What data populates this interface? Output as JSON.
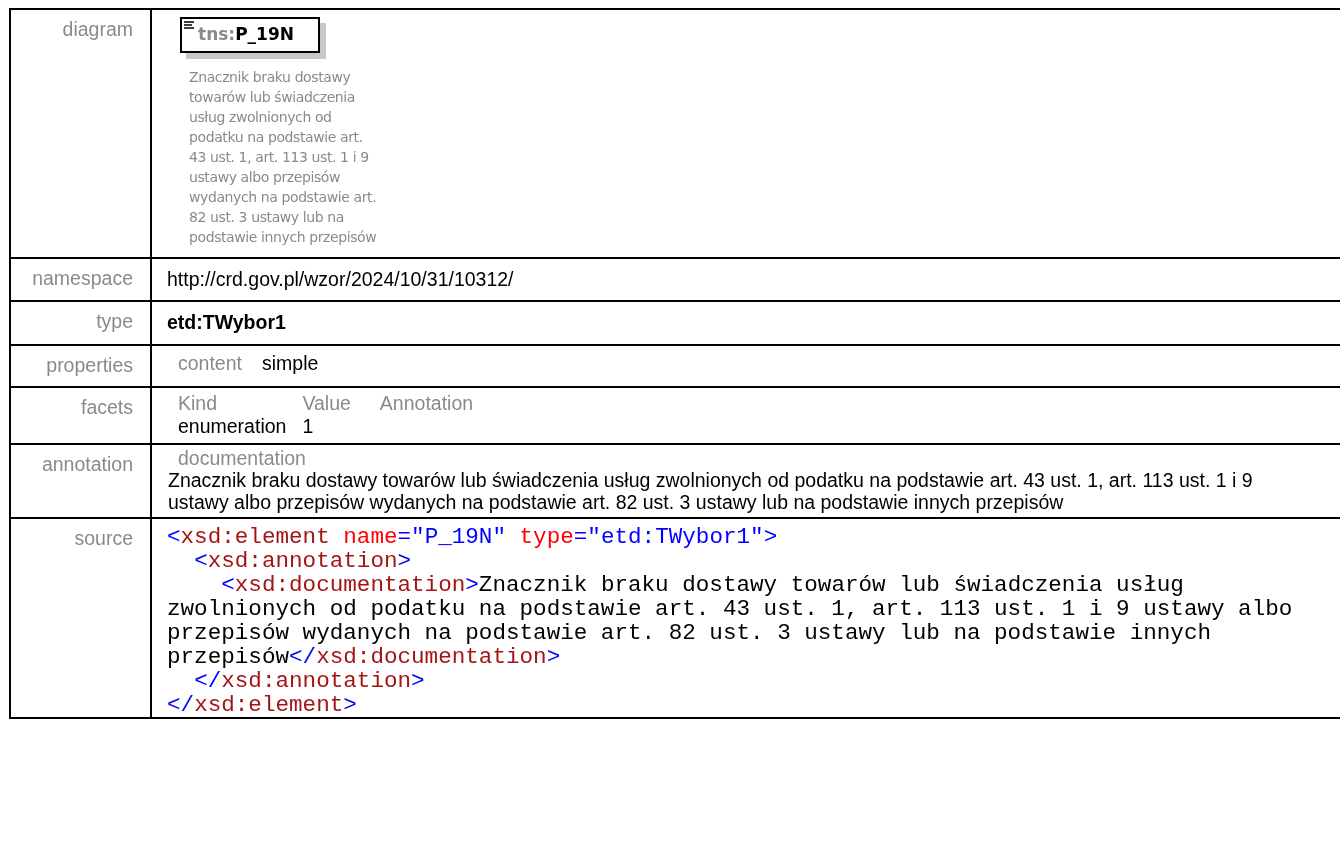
{
  "rows": [
    {
      "kind": "diagram",
      "label": "diagram",
      "prefix": "tns:",
      "name": "P_19N",
      "description": "Znacznik braku dostawy towarów lub świadczenia usług zwolnionych od podatku na podstawie art. 43 ust. 1, art. 113 ust. 1 i 9 ustawy albo przepisów wydanych na podstawie art. 82 ust. 3 ustawy lub na podstawie innych przepisów"
    },
    {
      "kind": "text",
      "label": "namespace",
      "value": "http://crd.gov.pl/wzor/2024/10/31/10312/"
    },
    {
      "kind": "bold",
      "label": "type",
      "value": "etd:TWybor1"
    },
    {
      "kind": "pairs",
      "label": "properties",
      "pairs": [
        {
          "key": "content",
          "value": "simple"
        }
      ]
    },
    {
      "kind": "facets",
      "label": "facets",
      "columns": [
        "Kind",
        "Value",
        "Annotation"
      ],
      "rows": [
        [
          "enumeration",
          "1",
          ""
        ]
      ]
    },
    {
      "kind": "annotation",
      "label": "annotation",
      "heading": "documentation",
      "value": "Znacznik braku dostawy towarów lub świadczenia usług zwolnionych od podatku na podstawie art. 43 ust. 1, art. 113 ust. 1 i 9 ustawy albo przepisów wydanych na podstawie art. 82 ust. 3 ustawy lub na podstawie innych przepisów"
    },
    {
      "kind": "source",
      "label": "source",
      "lines": [
        [
          {
            "kind": "bracket",
            "text": "<"
          },
          {
            "kind": "tag",
            "text": "xsd:element"
          },
          {
            "kind": "attr",
            "text": " name"
          },
          {
            "kind": "bracket",
            "text": "="
          },
          {
            "kind": "value",
            "text": "\"P_19N\""
          },
          {
            "kind": "attr",
            "text": " type"
          },
          {
            "kind": "bracket",
            "text": "="
          },
          {
            "kind": "value",
            "text": "\"etd:TWybor1\""
          },
          {
            "kind": "bracket",
            "text": ">"
          }
        ],
        [
          {
            "kind": "bracket",
            "text": "  <"
          },
          {
            "kind": "tag",
            "text": "xsd:annotation"
          },
          {
            "kind": "bracket",
            "text": ">"
          }
        ],
        [
          {
            "kind": "bracket",
            "text": "    <"
          },
          {
            "kind": "tag",
            "text": "xsd:documentation"
          },
          {
            "kind": "bracket",
            "text": ">"
          },
          {
            "kind": "text",
            "text": "Znacznik braku dostawy towarów lub świadczenia usług zwolnionych od podatku na podstawie art. 43 ust. 1, art. 113 ust. 1 i 9 ustawy albo przepisów wydanych na podstawie art. 82 ust. 3 ustawy lub na podstawie innych przepisów"
          },
          {
            "kind": "bracket",
            "text": "</"
          },
          {
            "kind": "tag",
            "text": "xsd:documentation"
          },
          {
            "kind": "bracket",
            "text": ">"
          }
        ],
        [
          {
            "kind": "bracket",
            "text": "  </"
          },
          {
            "kind": "tag",
            "text": "xsd:annotation"
          },
          {
            "kind": "bracket",
            "text": ">"
          }
        ],
        [
          {
            "kind": "bracket",
            "text": "</"
          },
          {
            "kind": "tag",
            "text": "xsd:element"
          },
          {
            "kind": "bracket",
            "text": ">"
          }
        ]
      ]
    }
  ]
}
